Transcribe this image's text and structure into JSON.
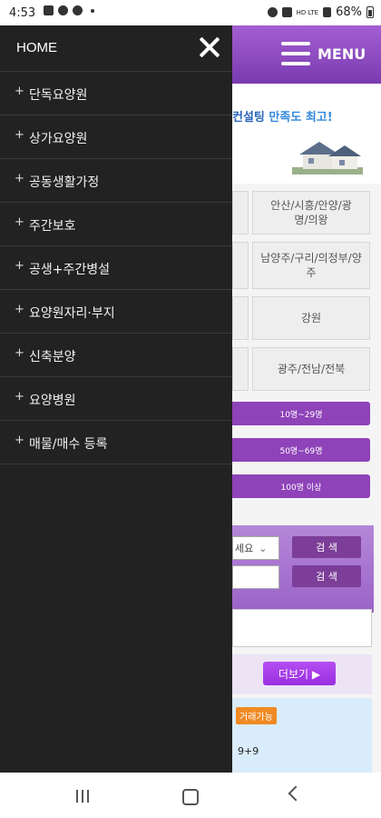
{
  "status_bar": {
    "time": "4:53",
    "network": "HD LTE",
    "battery": "68%"
  },
  "background_page": {
    "menu_label": "MENU",
    "banner": {
      "small_text": "",
      "headline_a": "컨설팅",
      "headline_b": " 만족도 최고!"
    },
    "grid": [
      [
        "",
        "안산/시흥/안양/광명/의왕"
      ],
      [
        "",
        "남양주/구리/의정부/양주"
      ],
      [
        "",
        "강원"
      ],
      [
        "",
        "광주/전남/전북"
      ]
    ],
    "pills": [
      "10명~29명",
      "50명~69명",
      "100명 이상"
    ],
    "search": {
      "select_text": "세요",
      "button1": "검 색",
      "button2": "검 색"
    },
    "more_button": "더보기 ▶",
    "badge": "거래가능",
    "panel_text": "9+9"
  },
  "drawer": {
    "home": "HOME",
    "items": [
      "단독요양원",
      "상가요양원",
      "공동생활가정",
      "주간보호",
      "공생+주간병설",
      "요양원자리·부지",
      "신축분양",
      "요양병원",
      "매물/매수 등록"
    ]
  },
  "colors": {
    "drawer_bg": "#222222",
    "brand_purple": "#8e43b8",
    "accent_orange": "#f08a24"
  }
}
